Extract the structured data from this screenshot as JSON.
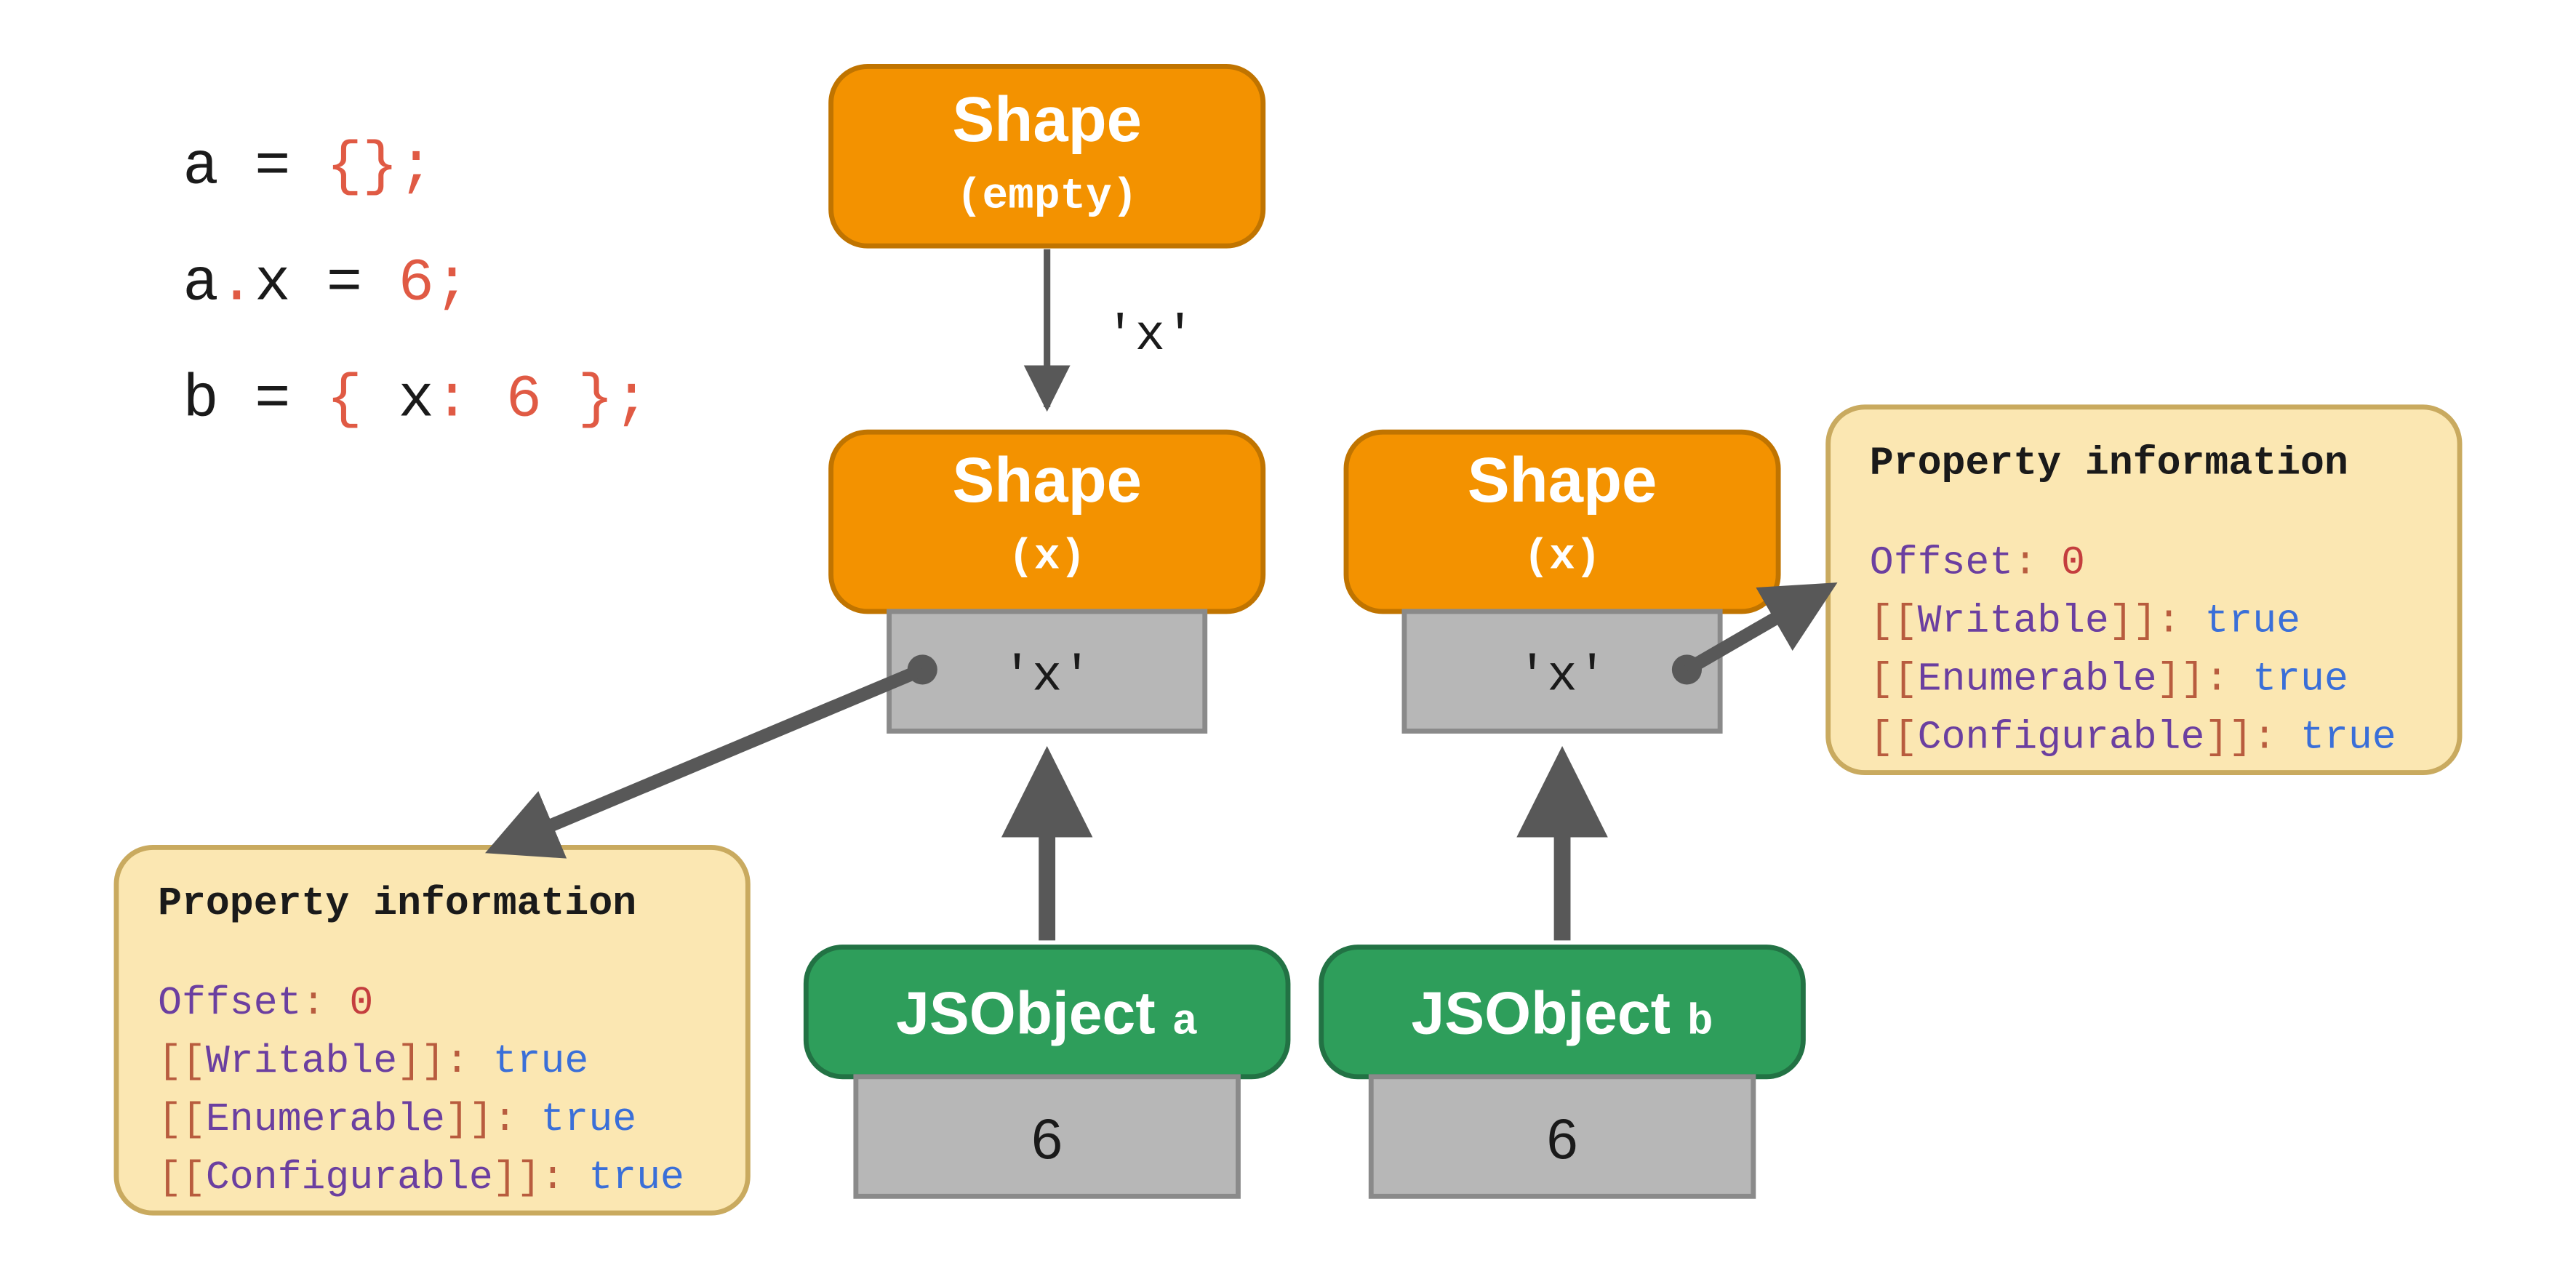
{
  "code": {
    "line1": {
      "var": "a",
      "op": " = ",
      "brace_open": "{",
      "brace_close": "}",
      "semi": ";"
    },
    "line2": {
      "var": "a",
      "dot": ".",
      "prop": "x",
      "op": " = ",
      "num": "6",
      "semi": ";"
    },
    "line3": {
      "var": "b",
      "op": " = ",
      "brace_open": "{ ",
      "prop": "x",
      "colon": ": ",
      "num": "6",
      "brace_close": " }",
      "semi": ";"
    }
  },
  "shape_empty": {
    "title": "Shape",
    "subtitle": "(empty)"
  },
  "shape_a": {
    "title": "Shape",
    "subtitle": "(x)",
    "prop": "'x'"
  },
  "shape_b": {
    "title": "Shape",
    "subtitle": "(x)",
    "prop": "'x'"
  },
  "edge_label": "'x'",
  "obj_a": {
    "title": "JSObject",
    "name": "a",
    "value": "6"
  },
  "obj_b": {
    "title": "JSObject",
    "name": "b",
    "value": "6"
  },
  "propinfo": {
    "title": "Property information",
    "offset_label": "Offset",
    "offset_value": "0",
    "writable_label": "Writable",
    "writable_value": "true",
    "enumerable_label": "Enumerable",
    "enumerable_value": "true",
    "configurable_label": "Configurable",
    "configurable_value": "true"
  },
  "colors": {
    "orange": "#F39200",
    "orange_stroke": "#C07400",
    "green": "#2E9E5B",
    "green_stroke": "#227244",
    "grey": "#B7B7B7",
    "grey_stroke": "#8A8A8A",
    "note_bg": "#FBE7B2",
    "note_stroke": "#C9AA5F",
    "arrow": "#585858",
    "code_var": "#1a1a1a",
    "code_op": "#1a1a1a",
    "code_punc": "#E05A44",
    "purple": "#6B3FA0",
    "brown": "#B85C3E",
    "blue": "#3A6FD8",
    "darkred": "#C43E3E"
  }
}
